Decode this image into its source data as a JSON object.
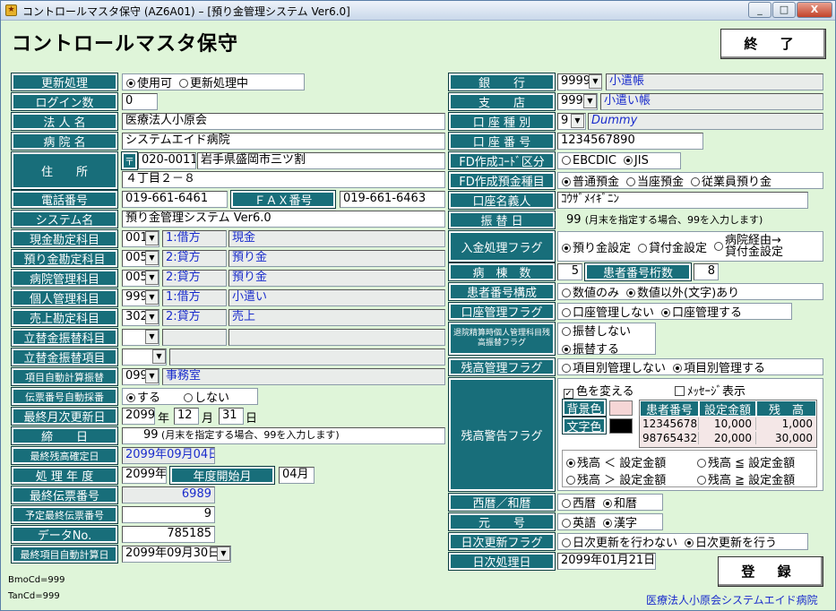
{
  "titlebar": {
    "title": "コントロールマスタ保守 (AZ6A01) – [預り金管理システム Ver6.0]",
    "min": "_",
    "max": "□",
    "close": "X"
  },
  "heading": "コントロールマスタ保守",
  "buttons": {
    "exit": "終 了",
    "register": "登 録"
  },
  "left": {
    "update_label": "更新処理",
    "update_opt1": "使用可",
    "update_opt2": "更新処理中",
    "login_label": "ログイン数",
    "login_value": "0",
    "corp_label": "法 人 名",
    "corp_value": "医療法人小原会",
    "hosp_label": "病 院 名",
    "hosp_value": "システムエイド病院",
    "addr_label": "住　　所",
    "zip_mark": "〒",
    "zip": "020-0011",
    "addr1": "岩手県盛岡市三ツ割",
    "addr2": "４丁目２－８",
    "tel_label": "電話番号",
    "tel": "019-661-6461",
    "fax_label": "ＦＡＸ番号",
    "fax": "019-661-6463",
    "sys_label": "システム名",
    "sys_value": "預り金管理システム Ver6.0",
    "accounts": [
      {
        "label": "現金勘定科目",
        "code": "001",
        "kind": "1:借方",
        "name": "現金"
      },
      {
        "label": "預り金勘定科目",
        "code": "005",
        "kind": "2:貸方",
        "name": "預り金"
      },
      {
        "label": "病院管理科目",
        "code": "005",
        "kind": "2:貸方",
        "name": "預り金"
      },
      {
        "label": "個人管理科目",
        "code": "999",
        "kind": "1:借方",
        "name": "小遣い"
      },
      {
        "label": "売上勘定科目",
        "code": "302",
        "kind": "2:貸方",
        "name": "売上"
      }
    ],
    "tatekae1_label": "立替金振替科目",
    "tatekae2_label": "立替金振替項目",
    "auto_calc_label": "項目自動計算振替",
    "auto_calc_code": "099",
    "auto_calc_name": "事務室",
    "slip_label": "伝票番号自動採番",
    "slip_opt1": "する",
    "slip_opt2": "しない",
    "last_monthly_label": "最終月次更新日",
    "lm_year": "2099",
    "lm_year_unit": "年",
    "lm_month": "12",
    "lm_month_unit": "月",
    "lm_day": "31",
    "lm_day_unit": "日",
    "close_label": "締　　日",
    "close_value": "99",
    "close_note": "(月末を指定する場合、99を入力します)",
    "last_balance_label": "最終残高確定日",
    "last_balance_value": "2099年09月04日",
    "fiscal_label": "処 理 年 度",
    "fiscal_value": "2099年",
    "fiscal_start_label": "年度開始月",
    "fiscal_start_value": "04月",
    "last_slip_label": "最終伝票番号",
    "last_slip_value": "6989",
    "planned_slip_label": "予定最終伝票番号",
    "planned_slip_value": "9",
    "data_no_label": "データNo.",
    "data_no_value": "785185",
    "last_auto_label": "最終項目自動計算日",
    "last_auto_value": "2099年09月30日",
    "bmo": "BmoCd=999",
    "tan": "TanCd=999"
  },
  "right": {
    "bank_label": "銀　　行",
    "bank_code": "9999",
    "bank_name": "小遣帳",
    "branch_label": "支　　店",
    "branch_code": "999",
    "branch_name": "小遣い帳",
    "acct_type_label": "口 座 種 別",
    "acct_type_code": "9",
    "acct_type_name": "Dummy",
    "acct_no_label": "口 座 番 号",
    "acct_no": "1234567890",
    "fd_kubun_label": "FD作成ｺｰﾄﾞ区分",
    "fd_opt1": "EBCDIC",
    "fd_opt2": "JIS",
    "fd_type_label": "FD作成預金種目",
    "fdt_opt1": "普通預金",
    "fdt_opt2": "当座預金",
    "fdt_opt3": "従業員預り金",
    "holder_label": "口座名義人",
    "holder": "ｺｳｻﾞﾒｲｷﾞﾆﾝ",
    "transfer_label": "振 替 日",
    "transfer_value": "99",
    "transfer_note": "(月末を指定する場合、99を入力します)",
    "deposit_label": "入金処理フラグ",
    "dep_opt1": "預り金設定",
    "dep_opt2": "貸付金設定",
    "dep_opt3a": "病院経由→",
    "dep_opt3b": "貸付金設定",
    "ward_label": "病　棟　数",
    "ward_value": "5",
    "pat_digits_label": "患者番号桁数",
    "pat_digits_value": "8",
    "pat_comp_label": "患者番号構成",
    "pc_opt1": "数値のみ",
    "pc_opt2": "数値以外(文字)あり",
    "acct_mgmt_label": "口座管理フラグ",
    "am_opt1": "口座管理しない",
    "am_opt2": "口座管理する",
    "retire_label": "退院精算時個人管理科目残高振替フラグ",
    "ret_opt1": "振替しない",
    "ret_opt2": "振替する",
    "bal_mgmt_label": "残高管理フラグ",
    "bm_opt1": "項目別管理しない",
    "bm_opt2": "項目別管理する",
    "warn_label": "残高警告フラグ",
    "warn": {
      "chk_color": "色を変える",
      "chk_msg": "ﾒｯｾｰｼﾞ表示",
      "bg_label": "背景色",
      "fg_label": "文字色",
      "col1": "患者番号",
      "col2": "設定金額",
      "col3": "残　高",
      "rows": [
        [
          "12345678",
          "10,000",
          "1,000"
        ],
        [
          "98765432",
          "20,000",
          "30,000"
        ]
      ],
      "c1": "残高 ＜ 設定金額",
      "c2": "残高 ≦ 設定金額",
      "c3": "残高 ＞ 設定金額",
      "c4": "残高 ≧ 設定金額",
      "bg_color": "#f5d6d6",
      "fg_color": "#000000"
    },
    "era_label": "西暦／和暦",
    "era_opt1": "西暦",
    "era_opt2": "和暦",
    "gengo_label": "元　　号",
    "gg_opt1": "英語",
    "gg_opt2": "漢字",
    "daily_label": "日次更新フラグ",
    "dl_opt1": "日次更新を行わない",
    "dl_opt2": "日次更新を行う",
    "daily_date_label": "日次処理日",
    "daily_date": "2099年01月21日",
    "footer": "医療法人小原会システムエイド病院"
  }
}
